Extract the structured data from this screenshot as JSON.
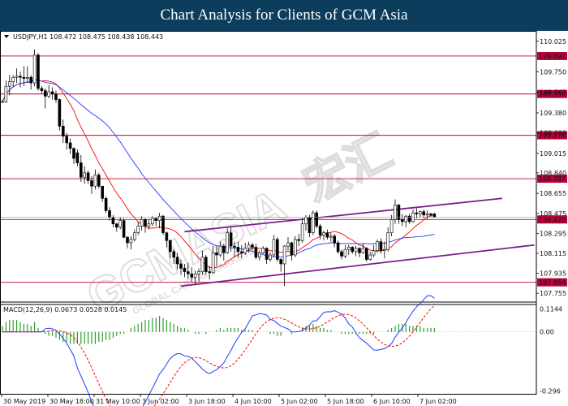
{
  "header": {
    "title": "Chart Analysis for Clients of GCM Asia"
  },
  "watermark": {
    "brand": "GCMASIA",
    "cn": "宏汇",
    "sub": "GLOBAL CAPITAL MARKETS"
  },
  "chart_data": {
    "type": "candlestick",
    "symbol_line": "USDJPY,H1  108.472 108.475 108.438 108.443",
    "indicator_line": "MACD(12,26,9) 0.0673 0.0528 0.0145",
    "x_ticks": [
      "30 May 2019",
      "30 May 18:00",
      "31 May 10:00",
      "3 Jun 02:00",
      "3 Jun 18:00",
      "4 Jun 10:00",
      "5 Jun 02:00",
      "5 Jun 18:00",
      "6 Jun 10:00",
      "7 Jun 02:00"
    ],
    "price_ticks": [
      110.025,
      109.75,
      109.565,
      109.38,
      109.2,
      109.015,
      108.84,
      108.655,
      108.475,
      108.295,
      108.115,
      107.935,
      107.755
    ],
    "price_range": [
      107.72,
      110.06
    ],
    "macd_ticks": [
      0.1144,
      0.0,
      -0.296
    ],
    "macd_range": [
      -0.31,
      0.125
    ],
    "levels": [
      {
        "value": 109.892,
        "label": "109.892"
      },
      {
        "value": 109.55,
        "label": "109.550"
      },
      {
        "value": 109.178,
        "label": "109.178"
      },
      {
        "value": 108.787,
        "label": "108.787"
      },
      {
        "value": 108.42,
        "label": "108.420"
      },
      {
        "value": 107.854,
        "label": "107.854"
      }
    ],
    "channel": [
      {
        "x0": 51,
        "y0": 108.31,
        "x1": 140,
        "y1": 108.61
      },
      {
        "x0": 50,
        "y0": 107.82,
        "x1": 149,
        "y1": 108.19
      }
    ],
    "ohlc": [
      [
        109.48,
        109.5,
        109.47,
        109.48
      ],
      [
        109.48,
        109.67,
        109.47,
        109.62
      ],
      [
        109.62,
        109.72,
        109.54,
        109.66
      ],
      [
        109.66,
        109.72,
        109.61,
        109.7
      ],
      [
        109.7,
        109.78,
        109.65,
        109.71
      ],
      [
        109.71,
        109.75,
        109.61,
        109.7
      ],
      [
        109.7,
        109.8,
        109.62,
        109.69
      ],
      [
        109.69,
        109.8,
        109.65,
        109.7
      ],
      [
        109.7,
        109.72,
        109.59,
        109.65
      ],
      [
        109.65,
        109.95,
        109.62,
        109.9
      ],
      [
        109.9,
        109.92,
        109.58,
        109.6
      ],
      [
        109.6,
        109.62,
        109.55,
        109.58
      ],
      [
        109.58,
        109.6,
        109.42,
        109.53
      ],
      [
        109.53,
        109.63,
        109.51,
        109.57
      ],
      [
        109.57,
        109.61,
        109.5,
        109.55
      ],
      [
        109.55,
        109.58,
        109.47,
        109.5
      ],
      [
        109.5,
        109.51,
        109.22,
        109.26
      ],
      [
        109.26,
        109.32,
        109.11,
        109.17
      ],
      [
        109.17,
        109.2,
        109.05,
        109.11
      ],
      [
        109.11,
        109.15,
        109.01,
        109.06
      ],
      [
        109.06,
        109.07,
        108.92,
        108.97
      ],
      [
        109.02,
        109.05,
        108.9,
        108.93
      ],
      [
        108.93,
        109.0,
        108.76,
        108.8
      ],
      [
        108.8,
        108.9,
        108.74,
        108.84
      ],
      [
        108.84,
        108.86,
        108.74,
        108.77
      ],
      [
        108.77,
        108.81,
        108.65,
        108.72
      ],
      [
        108.72,
        108.87,
        108.69,
        108.82
      ],
      [
        108.82,
        108.84,
        108.7,
        108.72
      ],
      [
        108.72,
        108.72,
        108.58,
        108.61
      ],
      [
        108.61,
        108.63,
        108.48,
        108.5
      ],
      [
        108.5,
        108.53,
        108.41,
        108.44
      ],
      [
        108.44,
        108.46,
        108.35,
        108.38
      ],
      [
        108.38,
        108.39,
        108.31,
        108.35
      ],
      [
        108.35,
        108.44,
        108.33,
        108.41
      ],
      [
        108.41,
        108.43,
        108.25,
        108.26
      ],
      [
        108.26,
        108.27,
        108.16,
        108.21
      ],
      [
        108.21,
        108.27,
        108.15,
        108.24
      ],
      [
        108.24,
        108.33,
        108.22,
        108.3
      ],
      [
        108.3,
        108.4,
        108.28,
        108.36
      ],
      [
        108.36,
        108.45,
        108.32,
        108.42
      ],
      [
        108.42,
        108.43,
        108.3,
        108.36
      ],
      [
        108.36,
        108.42,
        108.33,
        108.38
      ],
      [
        108.38,
        108.45,
        108.36,
        108.43
      ],
      [
        108.43,
        108.44,
        108.36,
        108.41
      ],
      [
        108.41,
        108.48,
        108.34,
        108.45
      ],
      [
        108.45,
        108.46,
        108.28,
        108.3
      ],
      [
        108.3,
        108.31,
        108.17,
        108.23
      ],
      [
        108.23,
        108.24,
        108.07,
        108.13
      ],
      [
        108.13,
        108.15,
        108.02,
        108.08
      ],
      [
        108.08,
        108.12,
        107.97,
        108.02
      ],
      [
        108.02,
        108.06,
        107.92,
        107.98
      ],
      [
        107.98,
        108.02,
        107.9,
        107.95
      ],
      [
        107.95,
        108.03,
        107.88,
        107.93
      ],
      [
        107.93,
        107.99,
        107.86,
        107.9
      ],
      [
        107.9,
        107.96,
        107.83,
        107.93
      ],
      [
        107.93,
        107.98,
        107.86,
        107.95
      ],
      [
        107.95,
        108.14,
        107.92,
        108.08
      ],
      [
        108.08,
        108.1,
        107.92,
        107.95
      ],
      [
        107.95,
        108.0,
        107.88,
        107.94
      ],
      [
        107.94,
        108.18,
        107.93,
        108.12
      ],
      [
        108.12,
        108.18,
        108.0,
        108.1
      ],
      [
        108.1,
        108.22,
        108.08,
        108.18
      ],
      [
        108.18,
        108.2,
        108.05,
        108.12
      ],
      [
        108.12,
        108.34,
        108.11,
        108.3
      ],
      [
        108.3,
        108.35,
        108.13,
        108.18
      ],
      [
        108.18,
        108.22,
        108.08,
        108.17
      ],
      [
        108.17,
        108.22,
        108.08,
        108.13
      ],
      [
        108.13,
        108.19,
        108.07,
        108.12
      ],
      [
        108.12,
        108.21,
        108.1,
        108.16
      ],
      [
        108.16,
        108.22,
        108.12,
        108.19
      ],
      [
        108.19,
        108.21,
        108.14,
        108.17
      ],
      [
        108.17,
        108.2,
        108.06,
        108.08
      ],
      [
        108.08,
        108.14,
        108.05,
        108.12
      ],
      [
        108.12,
        108.18,
        108.11,
        108.16
      ],
      [
        108.16,
        108.17,
        108.02,
        108.06
      ],
      [
        108.06,
        108.12,
        108.04,
        108.1
      ],
      [
        108.1,
        108.28,
        108.08,
        108.24
      ],
      [
        108.24,
        108.26,
        108.04,
        108.06
      ],
      [
        108.06,
        108.07,
        107.95,
        108.02
      ],
      [
        108.02,
        108.19,
        107.82,
        108.18
      ],
      [
        108.18,
        108.26,
        108.14,
        108.21
      ],
      [
        108.21,
        108.22,
        108.05,
        108.1
      ],
      [
        108.1,
        108.27,
        108.08,
        108.24
      ],
      [
        108.24,
        108.29,
        108.18,
        108.23
      ],
      [
        108.23,
        108.43,
        108.21,
        108.38
      ],
      [
        108.38,
        108.46,
        108.32,
        108.44
      ],
      [
        108.44,
        108.46,
        108.26,
        108.3
      ],
      [
        108.3,
        108.5,
        108.28,
        108.48
      ],
      [
        108.48,
        108.5,
        108.34,
        108.36
      ],
      [
        108.36,
        108.38,
        108.24,
        108.28
      ],
      [
        108.28,
        108.32,
        108.23,
        108.3
      ],
      [
        108.3,
        108.33,
        108.24,
        108.26
      ],
      [
        108.26,
        108.3,
        108.22,
        108.27
      ],
      [
        108.27,
        108.29,
        108.17,
        108.21
      ],
      [
        108.21,
        108.23,
        108.11,
        108.13
      ],
      [
        108.13,
        108.15,
        108.06,
        108.09
      ],
      [
        108.09,
        108.19,
        108.07,
        108.15
      ],
      [
        108.15,
        108.19,
        108.1,
        108.17
      ],
      [
        108.17,
        108.18,
        108.11,
        108.13
      ],
      [
        108.13,
        108.18,
        108.09,
        108.16
      ],
      [
        108.16,
        108.17,
        108.08,
        108.12
      ],
      [
        108.12,
        108.2,
        108.11,
        108.16
      ],
      [
        108.16,
        108.17,
        108.04,
        108.06
      ],
      [
        108.06,
        108.13,
        108.05,
        108.1
      ],
      [
        108.1,
        108.19,
        108.08,
        108.14
      ],
      [
        108.14,
        108.24,
        108.12,
        108.22
      ],
      [
        108.22,
        108.25,
        108.11,
        108.14
      ],
      [
        108.14,
        108.22,
        108.07,
        108.15
      ],
      [
        108.15,
        108.35,
        108.13,
        108.3
      ],
      [
        108.3,
        108.46,
        108.27,
        108.42
      ],
      [
        108.42,
        108.6,
        108.38,
        108.55
      ],
      [
        108.55,
        108.56,
        108.38,
        108.42
      ],
      [
        108.42,
        108.47,
        108.36,
        108.4
      ],
      [
        108.4,
        108.46,
        108.35,
        108.45
      ],
      [
        108.45,
        108.47,
        108.38,
        108.4
      ],
      [
        108.4,
        108.51,
        108.39,
        108.48
      ],
      [
        108.48,
        108.52,
        108.43,
        108.47
      ],
      [
        108.47,
        108.5,
        108.44,
        108.49
      ],
      [
        108.49,
        108.51,
        108.43,
        108.46
      ],
      [
        108.46,
        108.5,
        108.42,
        108.47
      ],
      [
        108.47,
        108.48,
        108.44,
        108.46
      ],
      [
        108.47,
        108.48,
        108.44,
        108.44
      ]
    ],
    "macd_hist": [
      0.03,
      0.05,
      0.06,
      0.06,
      0.06,
      0.05,
      0.04,
      0.04,
      0.03,
      0.05,
      0.02,
      0.0,
      -0.01,
      -0.02,
      -0.02,
      -0.03,
      -0.04,
      -0.05,
      -0.05,
      -0.06,
      -0.06,
      -0.06,
      -0.06,
      -0.06,
      -0.06,
      -0.06,
      -0.06,
      -0.05,
      -0.05,
      -0.04,
      -0.04,
      -0.03,
      -0.02,
      -0.01,
      -0.01,
      0.0,
      0.02,
      0.03,
      0.04,
      0.05,
      0.06,
      0.06,
      0.07,
      0.07,
      0.08,
      0.07,
      0.06,
      0.05,
      0.04,
      0.03,
      0.02,
      0.02,
      0.01,
      0.0,
      -0.01,
      -0.01,
      0.0,
      -0.01,
      0.0,
      0.0,
      0.01,
      0.02,
      0.01,
      0.02,
      0.02,
      0.02,
      0.02,
      0.01,
      0.01,
      0.01,
      0.01,
      0.0,
      0.0,
      0.0,
      0.0,
      -0.01,
      -0.01,
      -0.02,
      -0.02,
      0.0,
      0.0,
      -0.01,
      0.0,
      0.0,
      0.02,
      0.03,
      0.03,
      0.04,
      0.03,
      0.02,
      0.02,
      0.01,
      0.01,
      0.0,
      0.0,
      -0.01,
      -0.01,
      -0.01,
      -0.01,
      -0.01,
      -0.01,
      -0.01,
      -0.01,
      -0.01,
      -0.01,
      0.0,
      0.0,
      0.0,
      0.01,
      0.02,
      0.03,
      0.04,
      0.04,
      0.04,
      0.03,
      0.03,
      0.03,
      0.03,
      0.02,
      0.02,
      0.02,
      0.02
    ]
  }
}
